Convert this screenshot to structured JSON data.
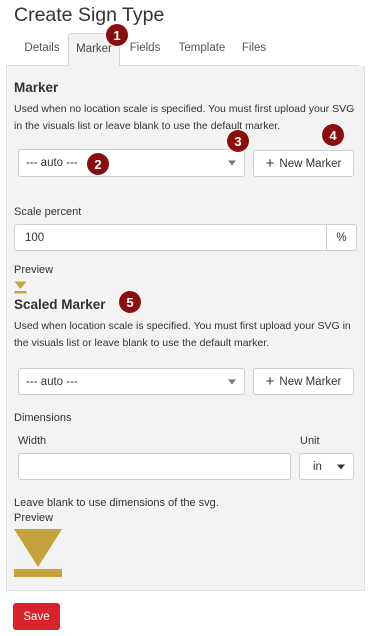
{
  "page_title": "Create Sign Type",
  "tabs": [
    {
      "label": "Details",
      "active": false
    },
    {
      "label": "Marker",
      "active": true
    },
    {
      "label": "Fields",
      "active": false
    },
    {
      "label": "Template",
      "active": false
    },
    {
      "label": "Files",
      "active": false
    }
  ],
  "marker": {
    "title": "Marker",
    "help": "Used when no location scale is specified. You must first upload your SVG in the visuals list or leave blank to use the default marker.",
    "select_value": "--- auto ---",
    "new_button": "New Marker",
    "scale_label": "Scale percent",
    "scale_value": "100",
    "scale_unit": "%",
    "preview_label": "Preview"
  },
  "scaled_marker": {
    "title": "Scaled Marker",
    "help": "Used when location scale is specified. You must first upload your SVG in the visuals list or leave blank to use the default marker.",
    "select_value": "--- auto ---",
    "new_button": "New Marker",
    "dimensions_label": "Dimensions",
    "width_label": "Width",
    "width_value": "",
    "unit_label": "Unit",
    "unit_value": "in",
    "hint": "Leave blank to use dimensions of the svg.",
    "preview_label": "Preview"
  },
  "annotations": [
    "1",
    "2",
    "3",
    "4",
    "5"
  ],
  "save_label": "Save",
  "colors": {
    "marker_gold": "#c6a23d",
    "badge": "#8b0e0e",
    "save": "#d9232a",
    "panel_bg": "#f3f3f3"
  }
}
